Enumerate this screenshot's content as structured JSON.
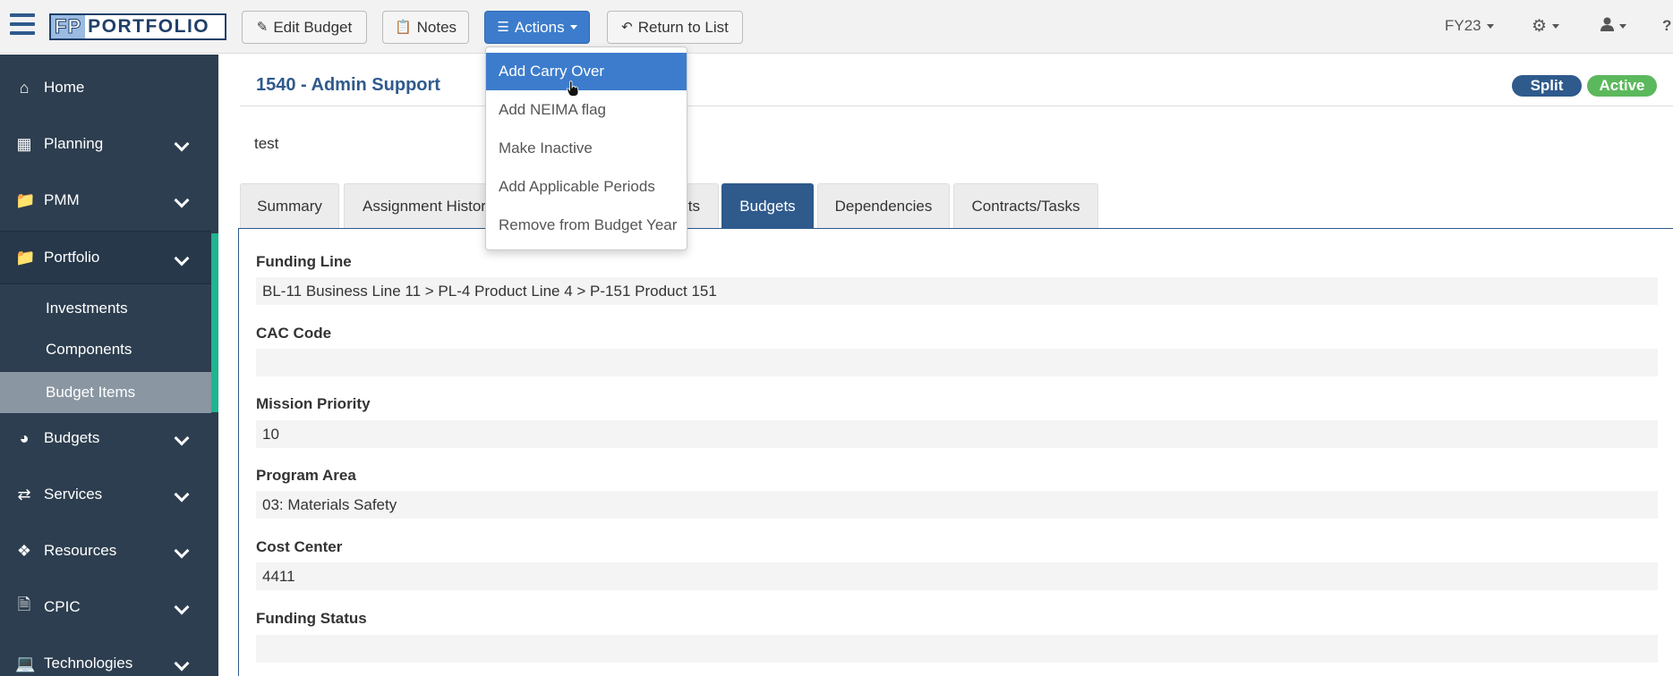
{
  "header": {
    "logo_fp": "FP",
    "logo_text": "PORTFOLIO",
    "edit_budget": "Edit Budget",
    "notes": "Notes",
    "actions": "Actions",
    "return_to_list": "Return to List",
    "fiscal_year": "FY23",
    "help": "?"
  },
  "actions_menu": {
    "items": [
      "Add Carry Over",
      "Add NEIMA flag",
      "Make Inactive",
      "Add Applicable Periods",
      "Remove from Budget Year"
    ]
  },
  "sidebar": {
    "items": [
      {
        "label": "Home",
        "icon": "home-icon"
      },
      {
        "label": "Planning",
        "icon": "table-icon"
      },
      {
        "label": "PMM",
        "icon": "folder-icon"
      },
      {
        "label": "Portfolio",
        "icon": "folder-icon"
      },
      {
        "label": "Budgets",
        "icon": "pie-chart-icon"
      },
      {
        "label": "Services",
        "icon": "exchange-icon"
      },
      {
        "label": "Resources",
        "icon": "cubes-icon"
      },
      {
        "label": "CPIC",
        "icon": "file-icon"
      },
      {
        "label": "Technologies",
        "icon": "laptop-icon"
      }
    ],
    "portfolio_sub": [
      "Investments",
      "Components",
      "Budget Items"
    ]
  },
  "page": {
    "title": "1540 - Admin Support",
    "badge_split": "Split",
    "badge_active": "Active",
    "description": "test"
  },
  "tabs": [
    "Summary",
    "Assignment Histor",
    "ts",
    "Budgets",
    "Dependencies",
    "Contracts/Tasks"
  ],
  "fields": [
    {
      "label": "Funding Line",
      "value": "BL-11 Business Line 11 > PL-4 Product Line 4 > P-151 Product 151"
    },
    {
      "label": "CAC Code",
      "value": ""
    },
    {
      "label": "Mission Priority",
      "value": "10"
    },
    {
      "label": "Program Area",
      "value": "03: Materials Safety"
    },
    {
      "label": "Cost Center",
      "value": "4411"
    },
    {
      "label": "Funding Status",
      "value": ""
    }
  ],
  "colors": {
    "brand_blue": "#2f5a8c",
    "action_blue": "#3d7ccc",
    "sidebar_bg": "#2d3e50",
    "accent_green": "#1fb58f",
    "badge_split": "#2f5a8c",
    "badge_active": "#5cb85c"
  }
}
